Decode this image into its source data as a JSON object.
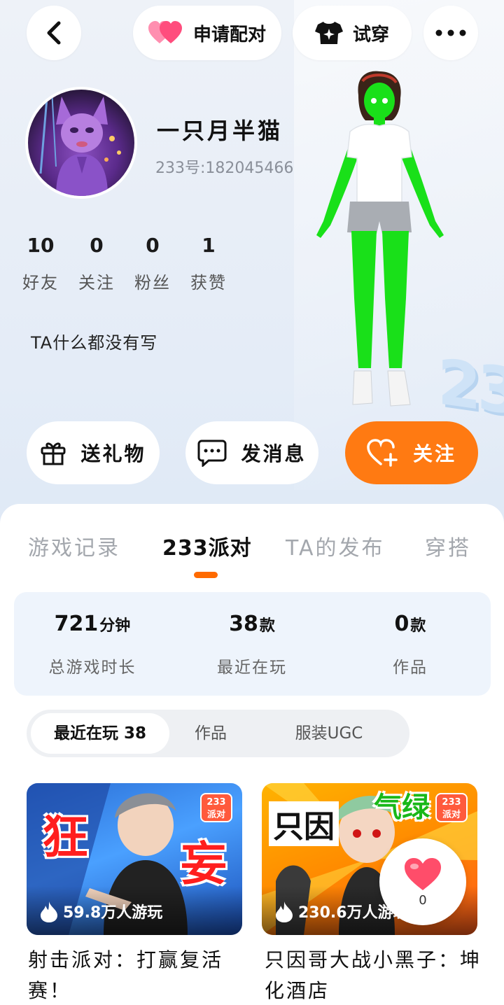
{
  "header": {
    "pair_label": "申请配对",
    "try_label": "试穿"
  },
  "profile": {
    "nickname": "一只月半猫",
    "uid": "233号:182045466",
    "bio": "TA什么都没有写",
    "stats": [
      {
        "value": "10",
        "label": "好友"
      },
      {
        "value": "0",
        "label": "关注"
      },
      {
        "value": "0",
        "label": "粉丝"
      },
      {
        "value": "1",
        "label": "获赞"
      }
    ]
  },
  "actions": {
    "gift_label": "送礼物",
    "message_label": "发消息",
    "follow_label": "关注"
  },
  "tabs": [
    {
      "label": "游戏记录"
    },
    {
      "label": "233派对"
    },
    {
      "label": "TA的发布"
    },
    {
      "label": "穿搭"
    }
  ],
  "summary": [
    {
      "value": "721",
      "unit": "分钟",
      "label": "总游戏时长"
    },
    {
      "value": "38",
      "unit": "款",
      "label": "最近在玩"
    },
    {
      "value": "0",
      "unit": "款",
      "label": "作品"
    }
  ],
  "segments": [
    {
      "label": "最近在玩 38"
    },
    {
      "label": "作品"
    },
    {
      "label": "服装UGC"
    }
  ],
  "cards": [
    {
      "plays": "59.8万人游玩",
      "title": "射击派对：打赢复活赛！",
      "cover_text": [
        "狂",
        "妄"
      ],
      "badge": [
        "233",
        "派对"
      ]
    },
    {
      "plays": "230.6万人游玩",
      "title": "只因哥大战小黑子：坤化酒店",
      "cover_text": [
        "只因",
        "气绿"
      ],
      "badge": [
        "233",
        "派对"
      ]
    }
  ],
  "like_float": {
    "count": "0"
  },
  "colors": {
    "accent": "#ff7a12",
    "tab_indicator": "#ff6a00",
    "summary_bg": "#eef4fc",
    "heart": "#ff4d6a"
  }
}
